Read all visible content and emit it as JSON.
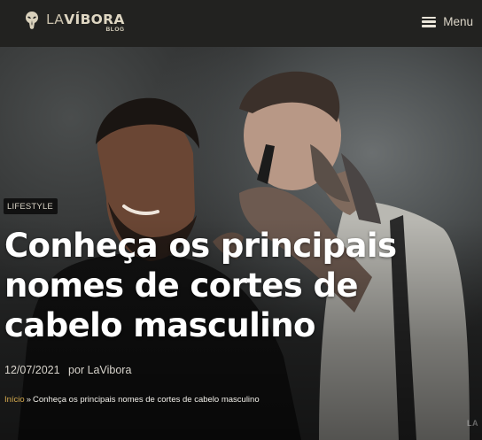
{
  "header": {
    "logo_prefix": "LA",
    "logo_main": "VÍBORA",
    "logo_sub": "BLOG",
    "menu_label": "Menu"
  },
  "post": {
    "category": "LIFESTYLE",
    "title": "Conheça os principais nomes de cortes de cabelo masculino",
    "date": "12/07/2021",
    "author_prefix": "por",
    "author": "LaVibora"
  },
  "breadcrumb": {
    "home": "Início",
    "separator": "»",
    "current": "Conheça os principais nomes de cortes de cabelo masculino"
  },
  "watermark": "LA",
  "colors": {
    "header_bg": "#222220",
    "link_gold": "#d6ab4e",
    "logo_cream": "#ded6c2"
  },
  "icons": {
    "logo": "snake-head-icon",
    "menu": "hamburger-icon"
  }
}
